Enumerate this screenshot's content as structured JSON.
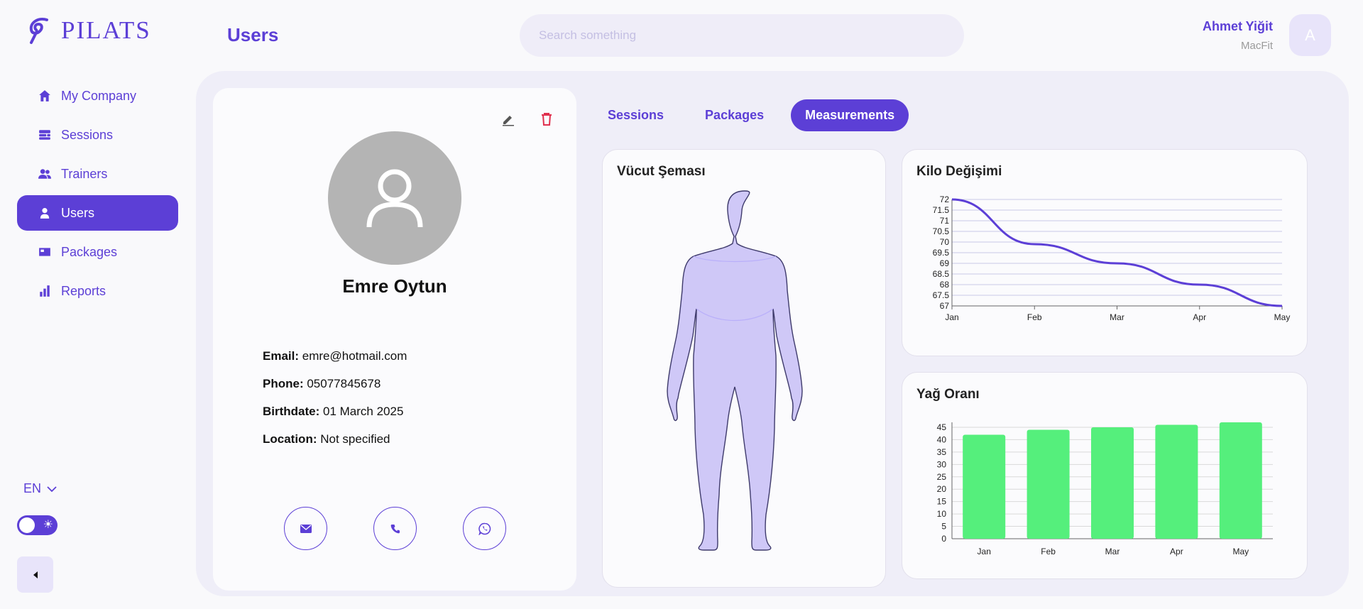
{
  "app": {
    "name": "PILATS"
  },
  "header": {
    "title": "Users",
    "search_placeholder": "Search something"
  },
  "user": {
    "name": "Ahmet Yiğit",
    "company": "MacFit",
    "avatar_letter": "A"
  },
  "sidebar": {
    "items": [
      {
        "label": "My Company",
        "icon": "home-icon",
        "active": false
      },
      {
        "label": "Sessions",
        "icon": "sessions-icon",
        "active": false
      },
      {
        "label": "Trainers",
        "icon": "trainers-icon",
        "active": false
      },
      {
        "label": "Users",
        "icon": "user-icon",
        "active": true
      },
      {
        "label": "Packages",
        "icon": "packages-icon",
        "active": false
      },
      {
        "label": "Reports",
        "icon": "reports-icon",
        "active": false
      }
    ],
    "language": "EN"
  },
  "profile": {
    "name": "Emre Oytun",
    "email_label": "Email:",
    "email": "emre@hotmail.com",
    "phone_label": "Phone:",
    "phone": "05077845678",
    "birthdate_label": "Birthdate:",
    "birthdate": "01 March 2025",
    "location_label": "Location:",
    "location": "Not specified"
  },
  "tabs": [
    {
      "label": "Sessions",
      "active": false
    },
    {
      "label": "Packages",
      "active": false
    },
    {
      "label": "Measurements",
      "active": true
    }
  ],
  "body_card": {
    "title": "Vücut Şeması"
  },
  "colors": {
    "accent": "#5c3fd6",
    "bar": "#55ef7c",
    "body_fill": "#cfc8f7"
  },
  "chart_data": [
    {
      "type": "line",
      "title": "Kilo Değişimi",
      "x": [
        "Jan",
        "Feb",
        "Mar",
        "Apr",
        "May"
      ],
      "values": [
        72,
        69.9,
        69.0,
        68.0,
        67.0
      ],
      "ylim": [
        67,
        72
      ],
      "yticks": [
        72,
        71.5,
        71,
        70.5,
        70,
        69.5,
        69,
        68.5,
        68,
        67.5,
        67
      ],
      "grid": true,
      "color": "#5c3fd6"
    },
    {
      "type": "bar",
      "title": "Yağ Oranı",
      "categories": [
        "Jan",
        "Feb",
        "Mar",
        "Apr",
        "May"
      ],
      "values": [
        42,
        44,
        45,
        46,
        47
      ],
      "ylim": [
        0,
        47
      ],
      "yticks": [
        45,
        40,
        35,
        30,
        25,
        20,
        15,
        10,
        5,
        0
      ],
      "grid": true,
      "color": "#55ef7c"
    }
  ]
}
